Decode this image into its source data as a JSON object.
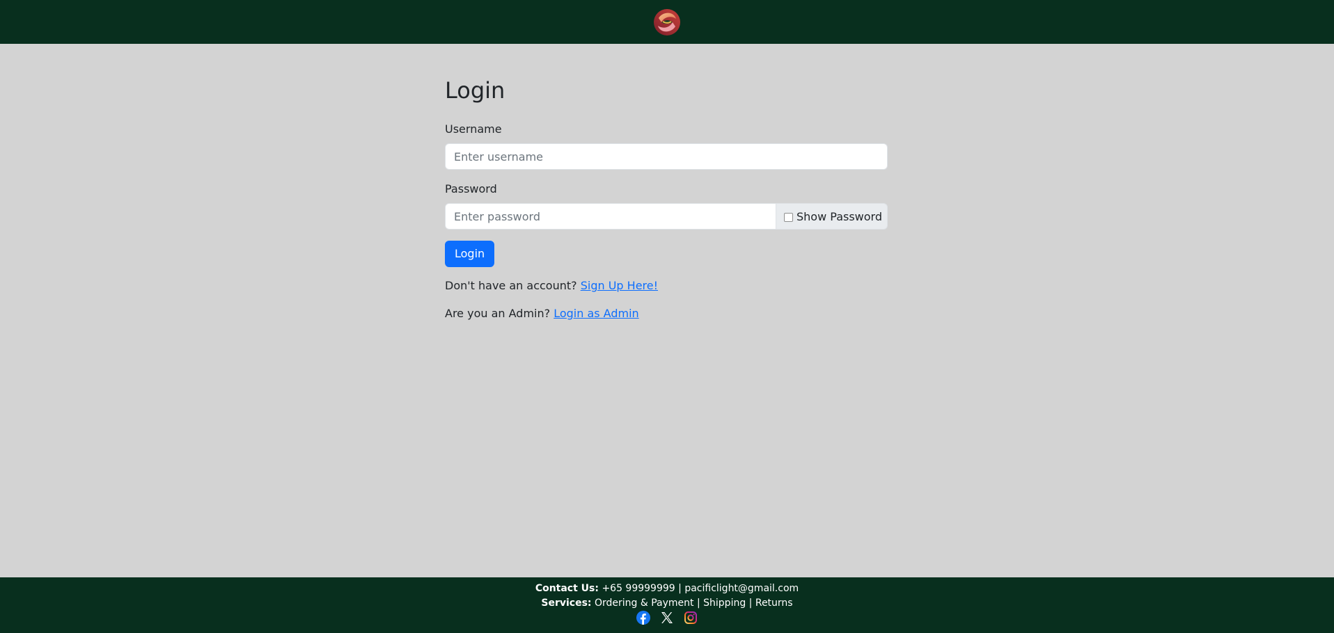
{
  "header": {
    "logo_icon": "pacific-light-logo"
  },
  "login": {
    "title": "Login",
    "username_label": "Username",
    "username_placeholder": "Enter username",
    "username_value": "",
    "password_label": "Password",
    "password_placeholder": "Enter password",
    "password_value": "",
    "show_password_label": "Show Password",
    "show_password_checked": false,
    "submit_label": "Login",
    "signup_prompt": "Don't have an account?",
    "signup_link": "Sign Up Here!",
    "admin_prompt": "Are you an Admin?",
    "admin_link": "Login as Admin"
  },
  "footer": {
    "contact_label": "Contact Us:",
    "contact_phone": "+65 99999999",
    "separator": "|",
    "contact_email": "pacificlight@gmail.com",
    "services_label": "Services:",
    "services": [
      "Ordering & Payment",
      "Shipping",
      "Returns"
    ],
    "social_icons": [
      "facebook-icon",
      "x-icon",
      "instagram-icon"
    ]
  },
  "colors": {
    "header_bg": "#082f1e",
    "page_bg": "#d3d3d3",
    "primary": "#0d6efd",
    "link": "#0d6efd"
  }
}
